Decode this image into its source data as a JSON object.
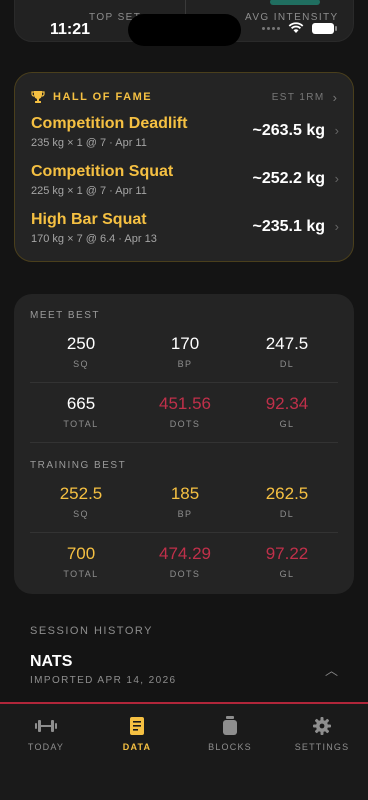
{
  "top_card": {
    "left_label": "TOP SET",
    "right_label": "AVG INTENSITY"
  },
  "status": {
    "time": "11:21"
  },
  "hall_of_fame": {
    "title": "HALL OF FAME",
    "metric_label": "EST 1RM",
    "entries": [
      {
        "name": "Competition Deadlift",
        "detail": "235 kg × 1 @ 7 · Apr 11",
        "value": "~263.5 kg"
      },
      {
        "name": "Competition Squat",
        "detail": "225 kg × 1 @ 7 · Apr 11",
        "value": "~252.2 kg"
      },
      {
        "name": "High Bar Squat",
        "detail": "170 kg × 7 @ 6.4 · Apr 13",
        "value": "~235.1 kg"
      }
    ]
  },
  "meet_best": {
    "label": "MEET BEST",
    "row1": [
      {
        "value": "250",
        "key": "SQ"
      },
      {
        "value": "170",
        "key": "BP"
      },
      {
        "value": "247.5",
        "key": "DL"
      }
    ],
    "row2": [
      {
        "value": "665",
        "key": "TOTAL"
      },
      {
        "value": "451.56",
        "key": "DOTS"
      },
      {
        "value": "92.34",
        "key": "GL"
      }
    ]
  },
  "training_best": {
    "label": "TRAINING BEST",
    "row1": [
      {
        "value": "252.5",
        "key": "SQ"
      },
      {
        "value": "185",
        "key": "BP"
      },
      {
        "value": "262.5",
        "key": "DL"
      }
    ],
    "row2": [
      {
        "value": "700",
        "key": "TOTAL"
      },
      {
        "value": "474.29",
        "key": "DOTS"
      },
      {
        "value": "97.22",
        "key": "GL"
      }
    ]
  },
  "session_history": {
    "label": "SESSION HISTORY",
    "name": "NATS",
    "subtitle": "IMPORTED APR 14, 2026"
  },
  "tabs": [
    {
      "label": "TODAY",
      "icon": "dumbbell-icon",
      "active": false
    },
    {
      "label": "DATA",
      "icon": "document-icon",
      "active": true
    },
    {
      "label": "BLOCKS",
      "icon": "blocks-icon",
      "active": false
    },
    {
      "label": "SETTINGS",
      "icon": "gear-icon",
      "active": false
    }
  ],
  "colors": {
    "accent": "#f5c042",
    "red": "#c0304a",
    "background": "#141414",
    "card": "#242424"
  }
}
